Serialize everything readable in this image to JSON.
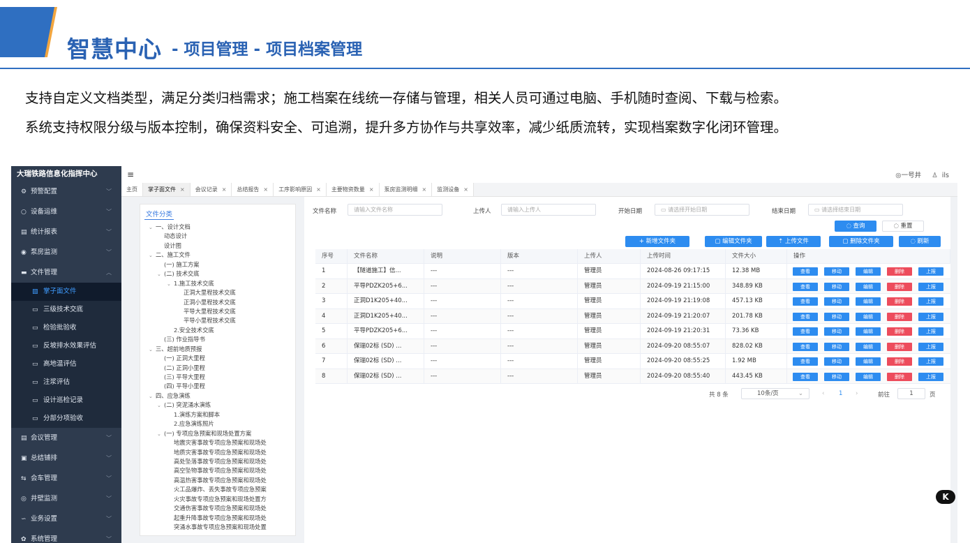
{
  "banner": {
    "title": "智慧中心",
    "subtitle": "- 项目管理 - 项目档案管理"
  },
  "intro": {
    "line1": "支持自定义文档类型，满足分类归档需求；施工档案在线统一存储与管理，相关人员可通过电脑、手机随时查阅、下载与检索。",
    "line2": "系统支持权限分级与版本控制，确保资料安全、可追溯，提升多方协作与共享效率，减少纸质流转，实现档案数字化闭环管理。"
  },
  "app": {
    "sidebar": {
      "title": "大瑞铁路信息化指挥中心",
      "items_top": [
        {
          "icon": "⚙",
          "label": "预警配置"
        },
        {
          "icon": "○",
          "label": "设备运维"
        },
        {
          "icon": "▤",
          "label": "统计报表"
        },
        {
          "icon": "◉",
          "label": "泵房监测"
        },
        {
          "icon": "▬",
          "label": "文件管理"
        }
      ],
      "subitems": [
        {
          "label": "掌子面文件"
        },
        {
          "label": "三级技术交底"
        },
        {
          "label": "检验批验收"
        },
        {
          "label": "反坡排水效果评估"
        },
        {
          "label": "高地温评估"
        },
        {
          "label": "注浆评估"
        },
        {
          "label": "设计巡检记录"
        },
        {
          "label": "分部分项验收"
        }
      ],
      "items_bottom": [
        {
          "icon": "▤",
          "label": "会议管理"
        },
        {
          "icon": "▣",
          "label": "总结铺排"
        },
        {
          "icon": "⇆",
          "label": "会车管理"
        },
        {
          "icon": "◎",
          "label": "井壁监测"
        },
        {
          "icon": "∽",
          "label": "业务设置"
        },
        {
          "icon": "✿",
          "label": "系统管理"
        }
      ]
    },
    "topbar": {
      "menu_icon": "≡",
      "location": "◎一号井",
      "user": "ils"
    },
    "tabs": [
      {
        "label": "主页"
      },
      {
        "label": "掌子面文件"
      },
      {
        "label": "会议记录"
      },
      {
        "label": "总结报告"
      },
      {
        "label": "工序影响原因"
      },
      {
        "label": "主要物资数量"
      },
      {
        "label": "泵房监测明细"
      },
      {
        "label": "监测设备"
      }
    ],
    "tree": {
      "head": "文件分类",
      "nodes": [
        {
          "t": "一、设计文档",
          "lvl": 1,
          "car": "⌄"
        },
        {
          "t": "动态设计",
          "lvl": 2,
          "car": ""
        },
        {
          "t": "设计图",
          "lvl": 2,
          "car": ""
        },
        {
          "t": "二、施工文件",
          "lvl": 1,
          "car": "⌄"
        },
        {
          "t": "(一) 施工方案",
          "lvl": 2,
          "car": ""
        },
        {
          "t": "(二) 技术交底",
          "lvl": 2,
          "car": "⌄"
        },
        {
          "t": "1.施工技术交底",
          "lvl": 3,
          "car": "⌄"
        },
        {
          "t": "正洞大里程技术交底",
          "lvl": 4,
          "car": ""
        },
        {
          "t": "正洞小里程技术交底",
          "lvl": 4,
          "car": ""
        },
        {
          "t": "平导大里程技术交底",
          "lvl": 4,
          "car": ""
        },
        {
          "t": "平导小里程技术交底",
          "lvl": 4,
          "car": ""
        },
        {
          "t": "2.安全技术交底",
          "lvl": 3,
          "car": ""
        },
        {
          "t": "(三) 作业指导书",
          "lvl": 2,
          "car": ""
        },
        {
          "t": "三、超前地质预报",
          "lvl": 1,
          "car": "⌄"
        },
        {
          "t": "(一) 正洞大里程",
          "lvl": 2,
          "car": ""
        },
        {
          "t": "(二) 正洞小里程",
          "lvl": 2,
          "car": ""
        },
        {
          "t": "(三) 平导大里程",
          "lvl": 2,
          "car": ""
        },
        {
          "t": "(四) 平导小里程",
          "lvl": 2,
          "car": ""
        },
        {
          "t": "四、应急演练",
          "lvl": 1,
          "car": "⌄"
        },
        {
          "t": "(二) 突泥涌水演练",
          "lvl": 2,
          "car": "⌄"
        },
        {
          "t": "1.演练方案和脚本",
          "lvl": 3,
          "car": ""
        },
        {
          "t": "2.应急演练照片",
          "lvl": 3,
          "car": ""
        },
        {
          "t": "(一) 专项应急预案和现场处置方案",
          "lvl": 2,
          "car": "⌄"
        },
        {
          "t": "地震灾害事故专项应急预案和现场处",
          "lvl": 3,
          "car": ""
        },
        {
          "t": "地质灾害事故专项应急预案和现场处",
          "lvl": 3,
          "car": ""
        },
        {
          "t": "高处坠落事故专项应急预案和现场处",
          "lvl": 3,
          "car": ""
        },
        {
          "t": "高空坠物事故专项应急预案和现场处",
          "lvl": 3,
          "car": ""
        },
        {
          "t": "高温热害事故专项应急预案和现场处",
          "lvl": 3,
          "car": ""
        },
        {
          "t": "火工品爆炸、丢失事故专项应急预案",
          "lvl": 3,
          "car": ""
        },
        {
          "t": "火灾事故专项应急预案和现场处置方",
          "lvl": 3,
          "car": ""
        },
        {
          "t": "交通伤害事故专项应急预案和现场处",
          "lvl": 3,
          "car": ""
        },
        {
          "t": "起重升降事故专项应急预案和现场处",
          "lvl": 3,
          "car": ""
        },
        {
          "t": "突涌水事故专项应急预案和现场处置",
          "lvl": 3,
          "car": ""
        }
      ]
    },
    "filters": {
      "file_name_label": "文件名称",
      "file_name_placeholder": "请输入文件名称",
      "uploader_label": "上传人",
      "uploader_placeholder": "请输入上传人",
      "start_label": "开始日期",
      "start_placeholder": "▭ 请选择开始日期",
      "end_label": "结束日期",
      "end_placeholder": "▭ 请选择结束日期",
      "query": "◌ 查询",
      "reset": "◌ 重置"
    },
    "actions": {
      "new_folder": "+ 新增文件夹",
      "edit_folder": "▢ 编辑文件夹",
      "upload": "⇡ 上传文件",
      "delete_folder": "▢ 删除文件夹",
      "refresh": "◌ 刷新"
    },
    "table": {
      "columns": [
        "序号",
        "文件名称",
        "说明",
        "版本",
        "上传人",
        "上传时间",
        "文件大小",
        "操作"
      ],
      "op_labels": [
        "查看",
        "移动",
        "编辑",
        "删除",
        "上报"
      ],
      "rows": [
        [
          "1",
          "【隧道施工】信...",
          "---",
          "---",
          "管理员",
          "2024-08-26 09:17:15",
          "12.38 MB"
        ],
        [
          "2",
          "平导PDZK205+6...",
          "---",
          "---",
          "管理员",
          "2024-09-19 21:15:00",
          "348.89 KB"
        ],
        [
          "3",
          "正洞D1K205+40...",
          "---",
          "---",
          "管理员",
          "2024-09-19 21:19:08",
          "457.13 KB"
        ],
        [
          "4",
          "正洞D1K205+40...",
          "---",
          "---",
          "管理员",
          "2024-09-19 21:20:07",
          "201.78 KB"
        ],
        [
          "5",
          "平导PDZK205+6...",
          "---",
          "---",
          "管理员",
          "2024-09-19 21:20:31",
          "73.36 KB"
        ],
        [
          "6",
          "保瑞02标 (SD) ...",
          "---",
          "---",
          "管理员",
          "2024-09-20 08:55:07",
          "828.02 KB"
        ],
        [
          "7",
          "保瑞02标 (SD) ...",
          "---",
          "---",
          "管理员",
          "2024-09-20 08:55:25",
          "1.92 MB"
        ],
        [
          "8",
          "保瑞02标 (SD) ...",
          "---",
          "---",
          "管理员",
          "2024-09-20 08:55:40",
          "443.45 KB"
        ]
      ]
    },
    "pager": {
      "total": "共 8 条",
      "page_size": "10条/页",
      "current": "1",
      "goto_label": "前往",
      "goto_value": "1",
      "page_suffix": "页"
    }
  },
  "badge": "K"
}
